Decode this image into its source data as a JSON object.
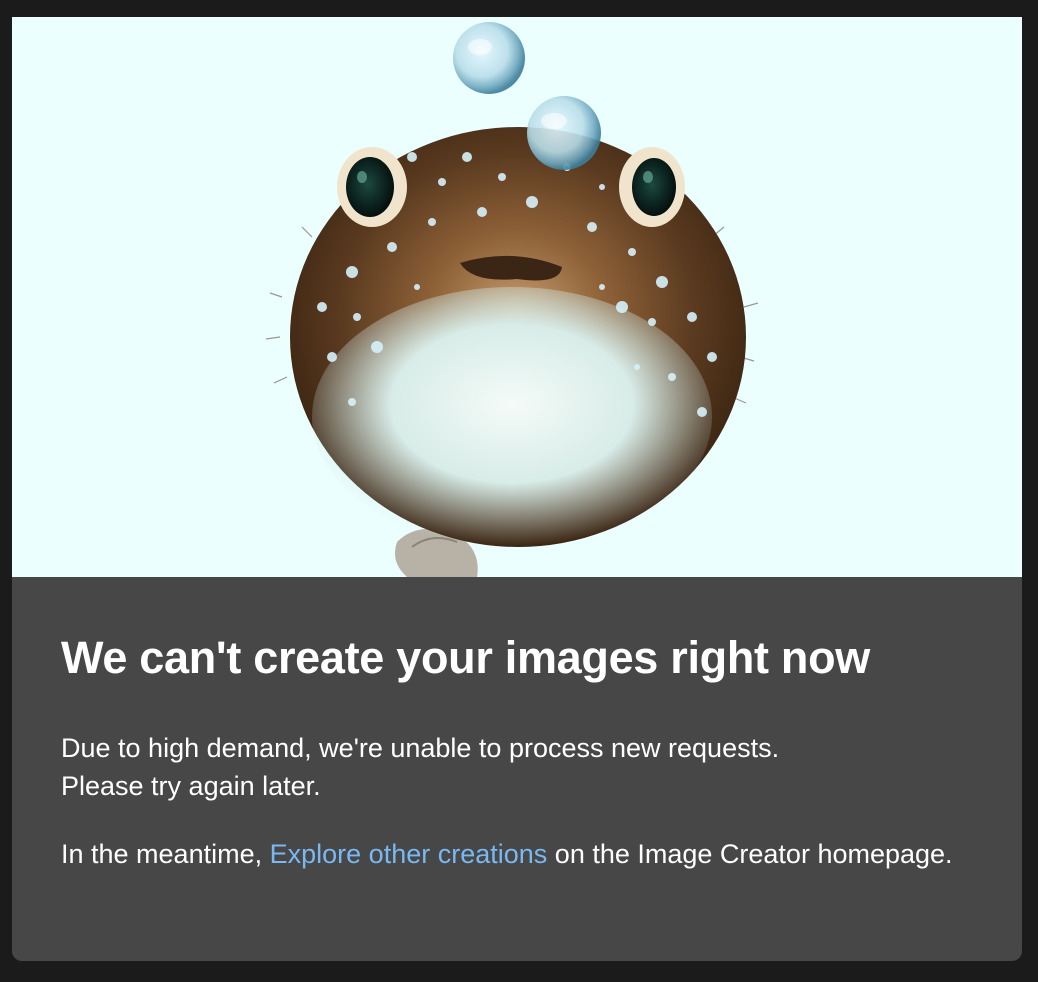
{
  "hero": {
    "image": "pufferfish-illustration",
    "background_color": "#ebffff"
  },
  "error": {
    "title": "We can't create your images right now",
    "message_line1": "Due to high demand, we're unable to process new requests.",
    "message_line2": "Please try again later.",
    "meantime_prefix": "In the meantime,",
    "link_text": "Explore other creations",
    "meantime_suffix": "on the Image Creator homepage."
  },
  "colors": {
    "panel_background": "#474747",
    "page_background": "#1b1b1b",
    "link": "#79b8f1",
    "text": "#ffffff"
  }
}
